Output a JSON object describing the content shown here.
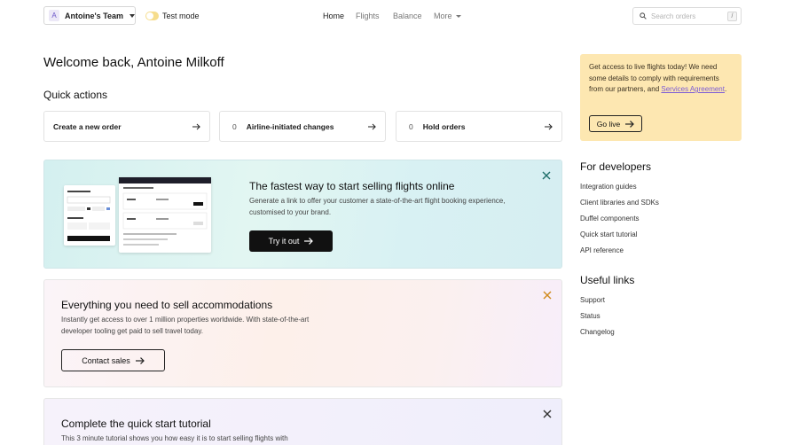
{
  "header": {
    "team_initial": "A",
    "team_name": "Antoine's Team",
    "test_mode_label": "Test mode",
    "nav": [
      "Home",
      "Flights",
      "Balance",
      "More"
    ],
    "search_placeholder": "Search orders",
    "search_shortcut": "/"
  },
  "main": {
    "welcome": "Welcome back, Antoine Milkoff",
    "quick_actions_title": "Quick actions",
    "quick_actions": [
      {
        "label": "Create a new order",
        "count": ""
      },
      {
        "label": "Airline-initiated changes",
        "count": "0"
      },
      {
        "label": "Hold orders",
        "count": "0"
      }
    ],
    "promo_links": {
      "title": "The fastest way to start selling flights online",
      "desc": "Generate a link to offer your customer a state-of-the-art flight booking experience, customised to your brand.",
      "button": "Try it out"
    },
    "promo_stays": {
      "title": "Everything you need to sell accommodations",
      "desc": "Instantly get access to over 1 million properties worldwide. With state-of-the-art developer tooling get paid to sell travel today.",
      "button": "Contact sales"
    },
    "promo_tutorial": {
      "title": "Complete the quick start tutorial",
      "desc": "This 3 minute tutorial shows you how easy it is to start selling flights with"
    }
  },
  "sidebar": {
    "notice_text": "Get access to live flights today! We need some details to comply with requirements from our partners, and",
    "notice_link": "Services Agreement",
    "notice_end": ".",
    "go_live": "Go live",
    "developers_title": "For developers",
    "developers_links": [
      "Integration guides",
      "Client libraries and SDKs",
      "Duffel components",
      "Quick start tutorial",
      "API reference"
    ],
    "useful_title": "Useful links",
    "useful_links": [
      "Support",
      "Status",
      "Changelog"
    ]
  },
  "colors": {
    "accent_link": "#7b5bd6",
    "notice_bg": "#fde7b1",
    "close_teal": "#1e6f6a",
    "close_orange": "#d08a1c"
  }
}
